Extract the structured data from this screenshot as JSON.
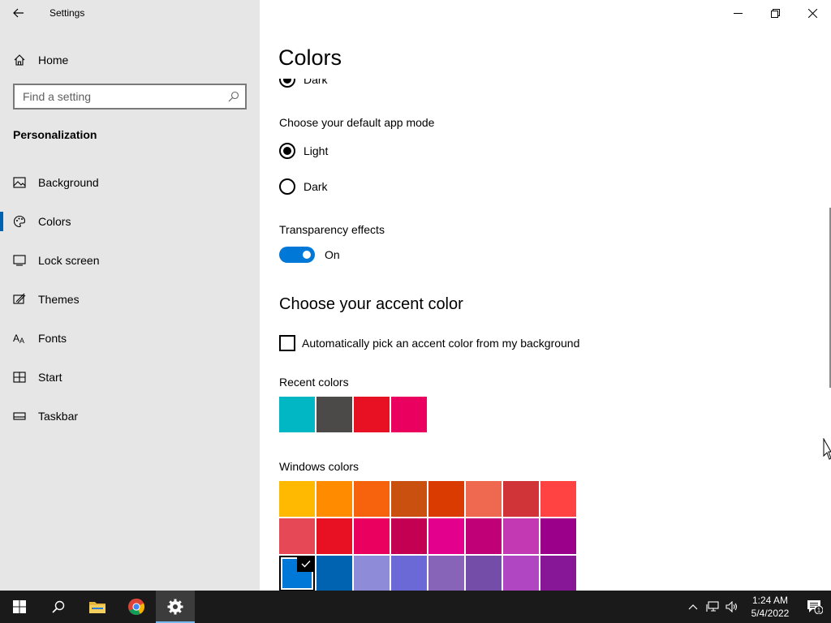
{
  "app": {
    "title": "Settings"
  },
  "sidebar": {
    "home_label": "Home",
    "search_placeholder": "Find a setting",
    "section_title": "Personalization",
    "items": [
      {
        "label": "Background",
        "icon": "picture-icon"
      },
      {
        "label": "Colors",
        "icon": "palette-icon",
        "active": true
      },
      {
        "label": "Lock screen",
        "icon": "lock-screen-icon"
      },
      {
        "label": "Themes",
        "icon": "themes-icon"
      },
      {
        "label": "Fonts",
        "icon": "fonts-icon"
      },
      {
        "label": "Start",
        "icon": "start-icon"
      },
      {
        "label": "Taskbar",
        "icon": "taskbar-icon"
      }
    ]
  },
  "main": {
    "page_title": "Colors",
    "windows_mode": {
      "selected_label": "Dark"
    },
    "app_mode": {
      "heading": "Choose your default app mode",
      "options": [
        {
          "label": "Light",
          "checked": true
        },
        {
          "label": "Dark",
          "checked": false
        }
      ]
    },
    "transparency": {
      "heading": "Transparency effects",
      "state_label": "On",
      "on": true
    },
    "accent": {
      "heading": "Choose your accent color",
      "auto_pick_label": "Automatically pick an accent color from my background",
      "auto_pick_checked": false,
      "recent_heading": "Recent colors",
      "recent_colors": [
        "#00b7c3",
        "#4c4a48",
        "#e81123",
        "#ea005e"
      ],
      "windows_heading": "Windows colors",
      "windows_colors": [
        [
          "#ffb900",
          "#ff8c00",
          "#f7630c",
          "#ca5010",
          "#da3b01",
          "#ef6950",
          "#d13438",
          "#ff4343"
        ],
        [
          "#e74856",
          "#e81123",
          "#ea005e",
          "#c30052",
          "#e3008c",
          "#bf0077",
          "#c239b3",
          "#9a0089"
        ],
        [
          "#0078d7",
          "#0063b1",
          "#8e8cd8",
          "#6b69d6",
          "#8764b8",
          "#744da9",
          "#b146c2",
          "#881798"
        ]
      ],
      "selected_color": "#0078d7"
    }
  },
  "taskbar": {
    "time": "1:24 AM",
    "date": "5/4/2022",
    "notification_count": "1"
  }
}
